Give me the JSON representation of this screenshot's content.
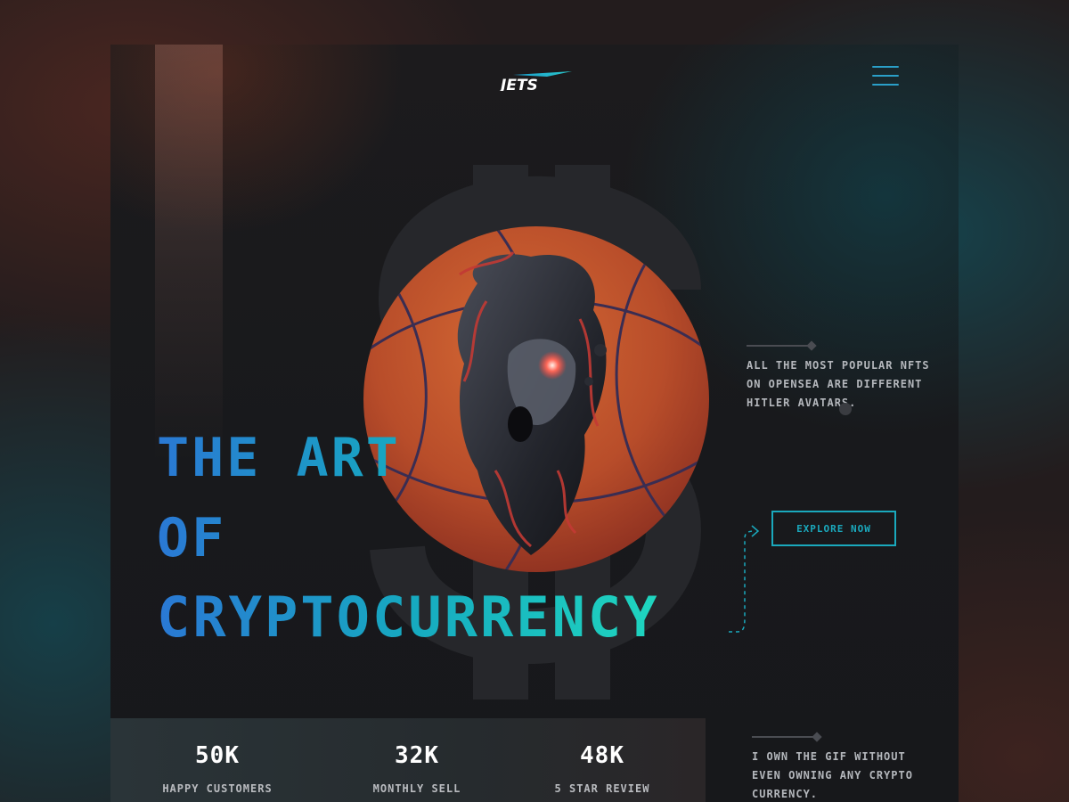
{
  "brand": {
    "logo_text": "JETS"
  },
  "header": {
    "menu_icon": "hamburger-menu-icon"
  },
  "hero": {
    "title_line1": "THE ART",
    "title_line2": "OF",
    "title_line3": "CRYPTOCURRENCY",
    "description": "ALL THE MOST POPULAR NFTS ON OPENSEA ARE DIFFERENT HITLER AVATARS.",
    "cta_label": "EXPLORE NOW",
    "background_symbol": "$",
    "artwork": "basketball-with-sculpted-head-artwork"
  },
  "stats": [
    {
      "value": "50K",
      "label": "HAPPY CUSTOMERS"
    },
    {
      "value": "32K",
      "label": "MONTHLY SELL"
    },
    {
      "value": "48K",
      "label": "5 STAR REVIEW"
    }
  ],
  "testimonial": {
    "text": "I OWN THE GIF WITHOUT EVEN OWNING ANY CRYPTO CURRENCY."
  },
  "colors": {
    "accent_cyan": "#1aa9bd",
    "accent_blue": "#2a78d4",
    "accent_teal": "#1fd6bf",
    "background": "#18191c",
    "ball_orange": "#c2542a"
  }
}
